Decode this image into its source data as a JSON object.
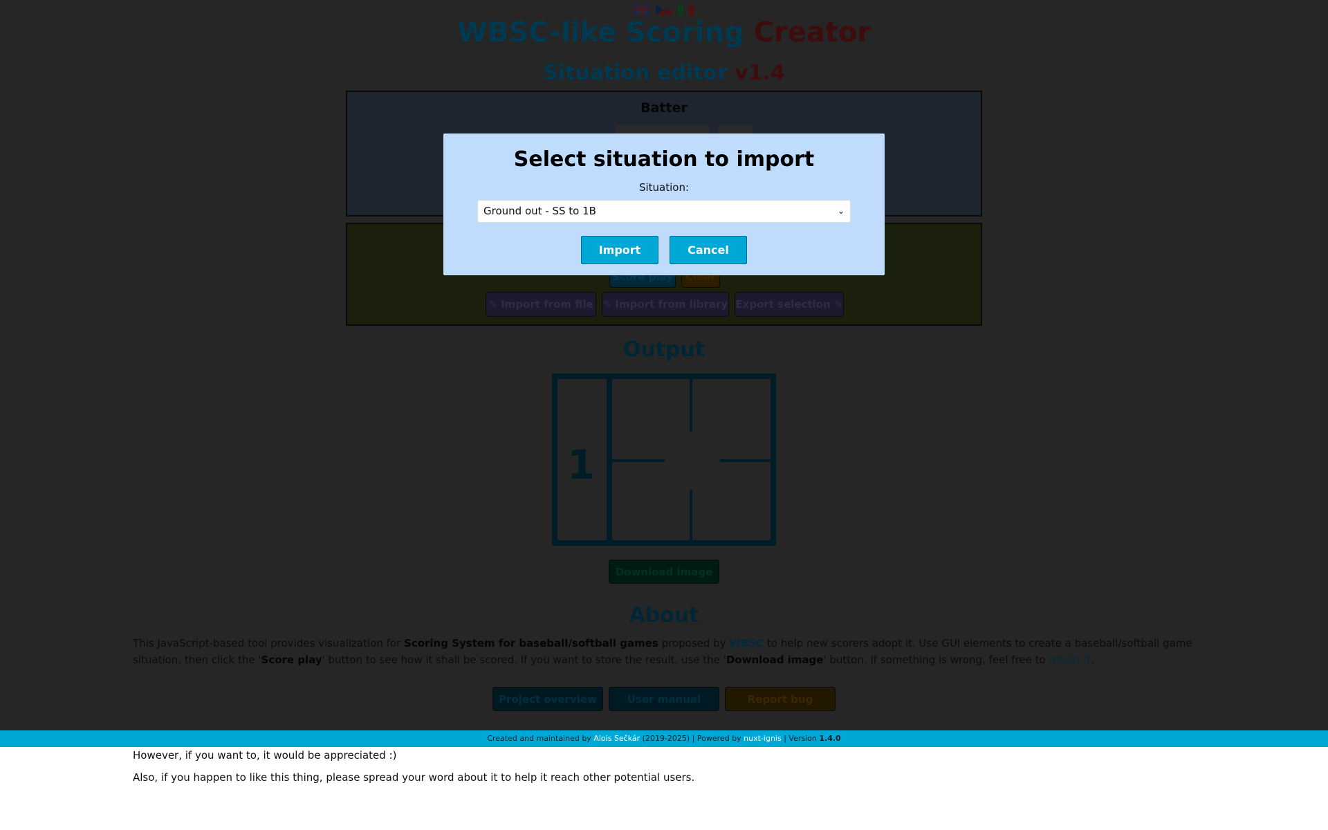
{
  "header": {
    "title_main": "WBSC-like Scoring ",
    "title_accent": "Creator",
    "subtitle_main": "Situation editor ",
    "subtitle_version": "v1.4",
    "flags": [
      "uk-flag",
      "cz-flag",
      "it-flag"
    ]
  },
  "batter": {
    "heading": "Batter"
  },
  "actions": {
    "score_play": "Score play",
    "clear": "Clear",
    "import_file": "✎ Import from file",
    "import_library": "✎ Import from library",
    "export_selection": "Export selection ✎"
  },
  "output": {
    "heading": "Output",
    "batter_number": "1",
    "download": "Download image"
  },
  "about": {
    "heading": "About",
    "p1": "This JavaScript-based tool provides visualization for ",
    "p1_bold": "Scoring System for baseball/softball games",
    "p1b": " proposed by ",
    "p1_link": "WBSC",
    "p1c": " to help new scorers adopt it. Use GUI elements to create a baseball/softball game situation, then click the '",
    "p1_bold2": "Score play",
    "p1d": "' button to see how it shall be scored. If you want to store the result, use the '",
    "p1_bold3": "Download image",
    "p1e": "' button. If something is wrong, feel free to ",
    "p1_link2": "report it",
    "p1f": ".",
    "buttons": [
      "Project overview",
      "User manual",
      "Report bug"
    ]
  },
  "footer": {
    "t1": "Created and maintained by ",
    "author": "Alois Sečkár",
    "t2": " (2019-2025) | Powered by ",
    "powered": "nuxt-ignis",
    "t3": " | Version ",
    "version": "1.4.0"
  },
  "extra": {
    "line1": "However, if you want to, it would be appreciated :)",
    "line2": "Also, if you happen to like this thing, please spread your word about it to help it reach other potential users."
  },
  "modal": {
    "title": "Select situation to import",
    "label": "Situation:",
    "selected": "Ground out - SS to 1B",
    "import": "Import",
    "cancel": "Cancel"
  }
}
